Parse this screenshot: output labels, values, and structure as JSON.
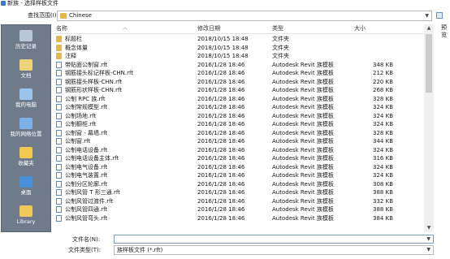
{
  "window": {
    "title": "新族 - 选择样板文件"
  },
  "toolbar": {
    "lookin_label": "查找范围(I):",
    "lookin_value": "Chinese",
    "preview_label": "预览"
  },
  "places": [
    {
      "label": "历史记录",
      "icon": "history-icon",
      "color": "#b9c7d6"
    },
    {
      "label": "文档",
      "icon": "documents-icon",
      "color": "#f0d27a"
    },
    {
      "label": "我的电脑",
      "icon": "computer-icon",
      "color": "#9cc3ea"
    },
    {
      "label": "我的网络位置",
      "icon": "network-icon",
      "color": "#7fb1e6"
    },
    {
      "label": "收藏夹",
      "icon": "favorites-icon",
      "color": "#f2c94c"
    },
    {
      "label": "桌面",
      "icon": "desktop-icon",
      "color": "#4a90d9"
    },
    {
      "label": "Library",
      "icon": "library-folder-icon",
      "color": "#f0c85a"
    }
  ],
  "columns": {
    "name": "名称",
    "date": "修改日期",
    "type": "类型",
    "size": "大小"
  },
  "files": [
    {
      "name": "标题栏",
      "date": "2018/10/15 18:48",
      "type": "文件夹",
      "size": "",
      "kind": "folder"
    },
    {
      "name": "概念体量",
      "date": "2018/10/15 18:48",
      "type": "文件夹",
      "size": "",
      "kind": "folder"
    },
    {
      "name": "注释",
      "date": "2018/10/15 18:48",
      "type": "文件夹",
      "size": "",
      "kind": "folder"
    },
    {
      "name": "带贴面公制窗.rft",
      "date": "2016/1/28 18:46",
      "type": "Autodesk Revit 族模板",
      "size": "348 KB",
      "kind": "file"
    },
    {
      "name": "钢筋接头标记样板-CHN.rft",
      "date": "2016/1/28 18:46",
      "type": "Autodesk Revit 族模板",
      "size": "212 KB",
      "kind": "file"
    },
    {
      "name": "钢筋接头样板-CHN.rft",
      "date": "2016/1/28 18:46",
      "type": "Autodesk Revit 族模板",
      "size": "220 KB",
      "kind": "file"
    },
    {
      "name": "钢筋形状样板-CHN.rft",
      "date": "2016/1/28 18:46",
      "type": "Autodesk Revit 族模板",
      "size": "268 KB",
      "kind": "file"
    },
    {
      "name": "公制 RPC 族.rft",
      "date": "2016/1/28 18:46",
      "type": "Autodesk Revit 族模板",
      "size": "328 KB",
      "kind": "file"
    },
    {
      "name": "公制常规模型.rft",
      "date": "2016/1/28 18:46",
      "type": "Autodesk Revit 族模板",
      "size": "324 KB",
      "kind": "file"
    },
    {
      "name": "公制场地.rft",
      "date": "2016/1/28 18:46",
      "type": "Autodesk Revit 族模板",
      "size": "324 KB",
      "kind": "file"
    },
    {
      "name": "公制橱柜.rft",
      "date": "2016/1/28 18:46",
      "type": "Autodesk Revit 族模板",
      "size": "324 KB",
      "kind": "file"
    },
    {
      "name": "公制窗 - 幕墙.rft",
      "date": "2016/1/28 18:46",
      "type": "Autodesk Revit 族模板",
      "size": "328 KB",
      "kind": "file"
    },
    {
      "name": "公制窗.rft",
      "date": "2016/1/28 18:46",
      "type": "Autodesk Revit 族模板",
      "size": "344 KB",
      "kind": "file"
    },
    {
      "name": "公制电话设备.rft",
      "date": "2016/1/28 18:46",
      "type": "Autodesk Revit 族模板",
      "size": "324 KB",
      "kind": "file"
    },
    {
      "name": "公制电话设备主体.rft",
      "date": "2016/1/28 18:46",
      "type": "Autodesk Revit 族模板",
      "size": "316 KB",
      "kind": "file"
    },
    {
      "name": "公制电气设备.rft",
      "date": "2016/1/28 18:46",
      "type": "Autodesk Revit 族模板",
      "size": "324 KB",
      "kind": "file"
    },
    {
      "name": "公制电气装置.rft",
      "date": "2016/1/28 18:46",
      "type": "Autodesk Revit 族模板",
      "size": "324 KB",
      "kind": "file"
    },
    {
      "name": "公制分区轮廓.rft",
      "date": "2016/1/28 18:46",
      "type": "Autodesk Revit 族模板",
      "size": "308 KB",
      "kind": "file"
    },
    {
      "name": "公制风管 T 形三通.rft",
      "date": "2016/1/28 18:46",
      "type": "Autodesk Revit 族模板",
      "size": "388 KB",
      "kind": "file"
    },
    {
      "name": "公制风管过渡件.rft",
      "date": "2016/1/28 18:46",
      "type": "Autodesk Revit 族模板",
      "size": "332 KB",
      "kind": "file"
    },
    {
      "name": "公制风管四通.rft",
      "date": "2016/1/28 18:46",
      "type": "Autodesk Revit 族模板",
      "size": "388 KB",
      "kind": "file"
    },
    {
      "name": "公制风管弯头.rft",
      "date": "2016/1/28 18:46",
      "type": "Autodesk Revit 族模板",
      "size": "384 KB",
      "kind": "file"
    }
  ],
  "footer": {
    "filename_label": "文件名(N):",
    "filename_value": "",
    "filetype_label": "文件类型(T):",
    "filetype_value": "族样板文件 (*.rft)"
  }
}
